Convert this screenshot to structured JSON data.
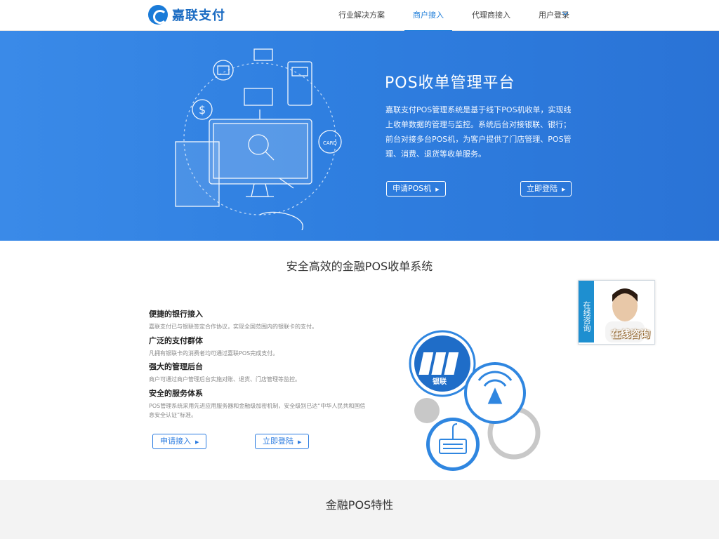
{
  "header": {
    "logo_text": "嘉联支付",
    "nav": [
      {
        "label": "行业解决方案",
        "active": false
      },
      {
        "label": "商户接入",
        "active": true
      },
      {
        "label": "代理商接入",
        "active": false
      },
      {
        "label": "用户登录",
        "active": false
      }
    ]
  },
  "banner": {
    "title": "POS收单管理平台",
    "description": "嘉联支付POS管理系统是基于线下POS机收单，实现线上收单数据的管理与监控。系统后台对接银联、银行；前台对接多台POS机，为客户提供了门店管理、POS管理、消费、退货等收单服务。",
    "btn_apply": "申请POS机",
    "btn_login": "立即登陆",
    "card_text": "CARD"
  },
  "section1": {
    "title": "安全高效的金融POS收单系统",
    "features": [
      {
        "title": "便捷的银行接入",
        "desc": "嘉联支付已与银联签定合作协议，实现全国范围内的银联卡的支付。"
      },
      {
        "title": "广泛的支付群体",
        "desc": "凡拥有银联卡的消费者均可通过嘉联POS完成支付。"
      },
      {
        "title": "强大的管理后台",
        "desc": "商户可通过商户管理后台实施对账、退货、门店管理等监控。"
      },
      {
        "title": "安全的服务体系",
        "desc": "POS管理系统采用先进应用服务器和金融级加密机制，安全级别已达“中华人民共和国信息安全认证”标准。"
      }
    ],
    "btn_apply": "申请接入",
    "btn_login": "立即登陆",
    "unionpay_text": "银联"
  },
  "consult": {
    "tab_label": "在线咨询",
    "label": "在线咨询"
  },
  "section2": {
    "title": "金融POS特性"
  },
  "colors": {
    "brand_blue": "#1a7bd8",
    "banner_blue": "#2f7fe0"
  }
}
